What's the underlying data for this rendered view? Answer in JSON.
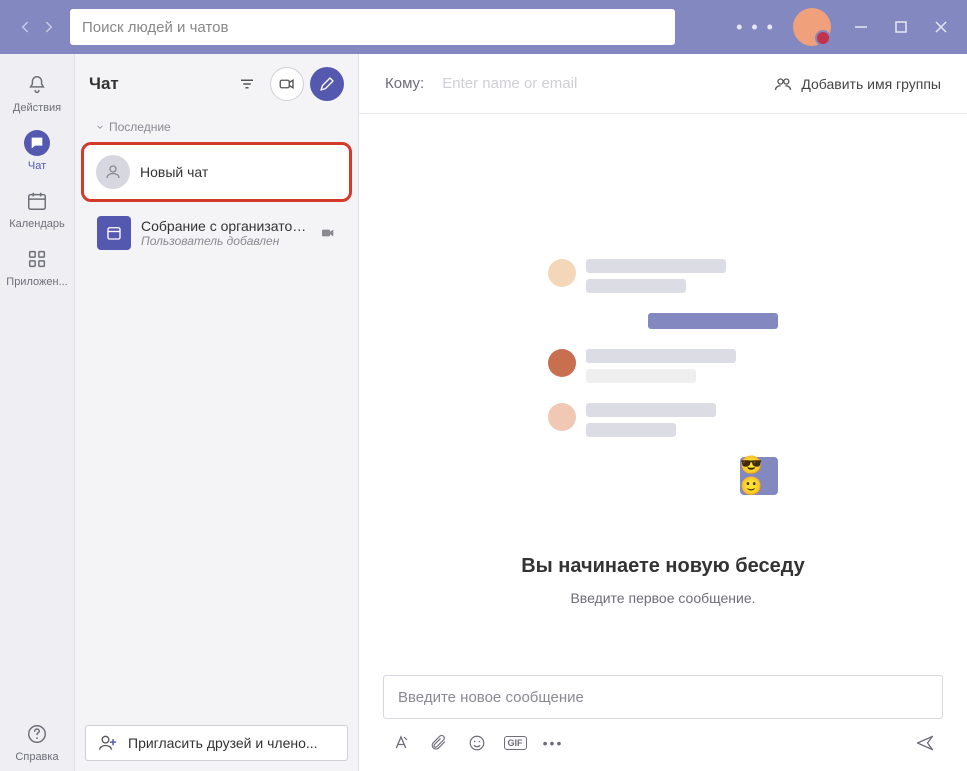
{
  "titlebar": {
    "search_placeholder": "Поиск людей и чатов"
  },
  "rail": {
    "activity": "Действия",
    "chat": "Чат",
    "calendar": "Календарь",
    "apps": "Приложен...",
    "help": "Справка"
  },
  "chat_list": {
    "title": "Чат",
    "section_recent": "Последние",
    "items": [
      {
        "title": "Новый чат",
        "subtitle": ""
      },
      {
        "title": "Собрание с организатором ...",
        "subtitle": "Пользователь добавлен"
      }
    ],
    "invite_label": "Пригласить друзей и члено..."
  },
  "main": {
    "to_label": "Кому:",
    "to_placeholder": "Enter name or email",
    "add_group_label": "Добавить имя группы",
    "empty_title": "Вы начинаете новую беседу",
    "empty_sub": "Введите первое сообщение.",
    "composer_placeholder": "Введите новое сообщение",
    "gif_label": "GIF"
  }
}
